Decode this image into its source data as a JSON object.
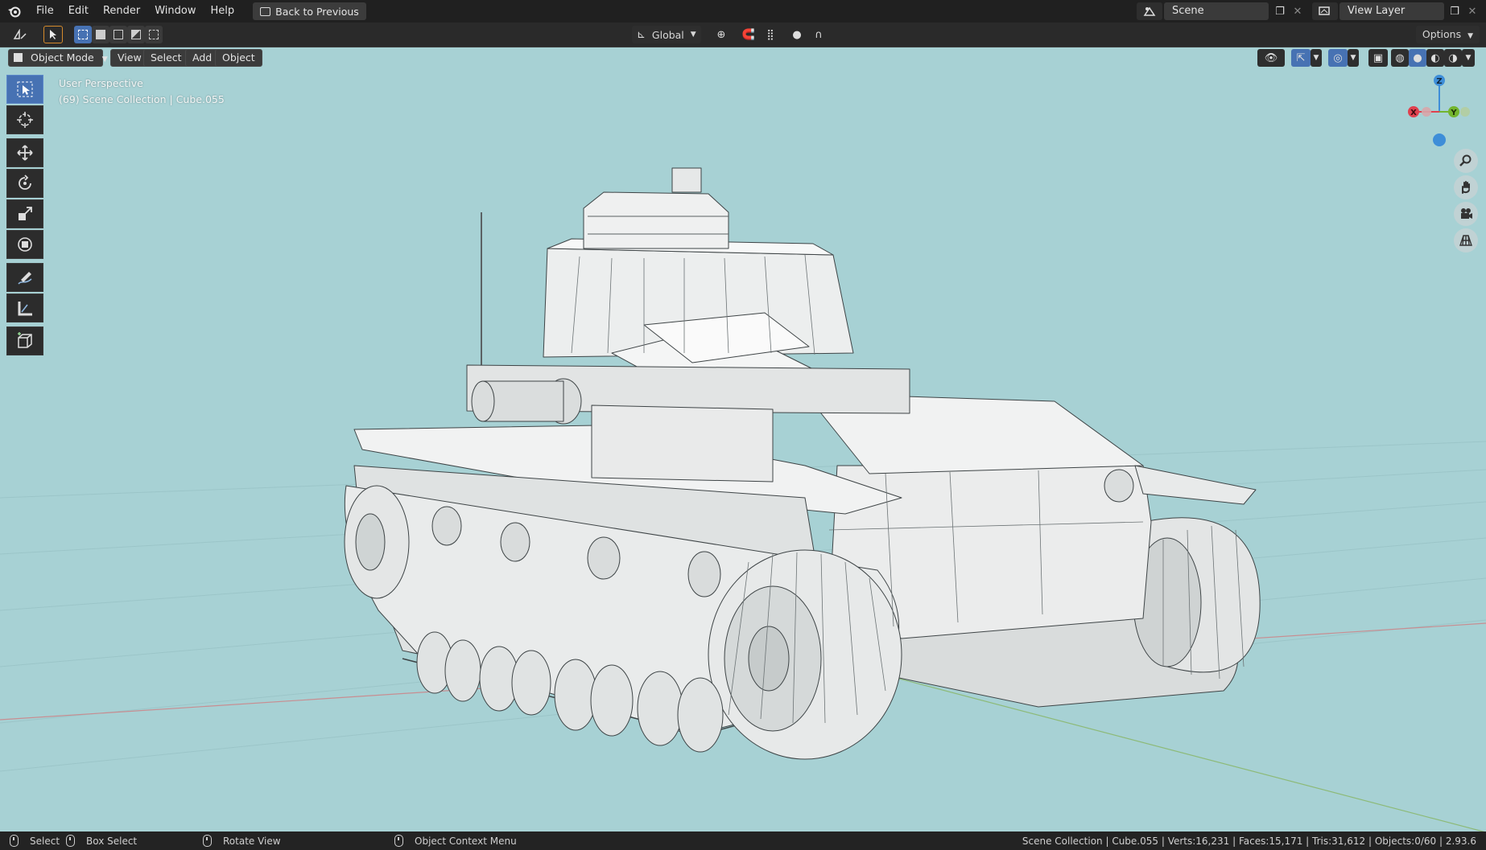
{
  "menu": {
    "items": [
      "File",
      "Edit",
      "Render",
      "Window",
      "Help"
    ],
    "back_button": "Back to Previous"
  },
  "scene": {
    "label": "Scene",
    "view_layer": "View Layer"
  },
  "toolbar": {
    "transform_orientation": "Global",
    "options": "Options"
  },
  "header": {
    "mode": "Object Mode",
    "view": "View",
    "select": "Select",
    "add": "Add",
    "object": "Object"
  },
  "viewport": {
    "perspective_label": "User Perspective",
    "collection_label": "(69) Scene Collection | Cube.055",
    "background_color": "#a7d1d4"
  },
  "gizmo": {
    "x": "X",
    "y": "Y",
    "z": "Z",
    "x_color": "#e0414f",
    "y_color": "#73b52e",
    "z_color": "#3e8ed8"
  },
  "status": {
    "select": "Select",
    "box_select": "Box Select",
    "rotate_view": "Rotate View",
    "context_menu": "Object Context Menu",
    "stats": "Scene Collection | Cube.055 | Verts:16,231 | Faces:15,171 | Tris:31,612 | Objects:0/60 | 2.93.6"
  },
  "tools": [
    "select-box-icon",
    "cursor-icon",
    "move-icon",
    "rotate-icon",
    "scale-icon",
    "transform-icon",
    "annotate-icon",
    "measure-icon",
    "add-cube-icon"
  ],
  "accent_color": "#4772b3"
}
